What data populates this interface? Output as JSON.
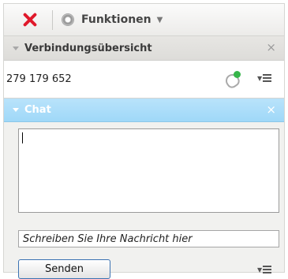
{
  "toolbar": {
    "close_icon": "red-x-icon",
    "functions_icon": "gear-icon",
    "functions_label": "Funktionen",
    "functions_arrow": "▼"
  },
  "connection_overview": {
    "title": "Verbindungsübersicht",
    "close_glyph": "×",
    "connection_id": "279 179 652",
    "remote_icon": "remote-control-icon",
    "menu_icon": "dropdown-menu-icon"
  },
  "chat": {
    "title": "Chat",
    "close_glyph": "×",
    "log_text": "",
    "input_placeholder": "Schreiben Sie Ihre Nachricht hier",
    "input_value": "",
    "send_label": "Senden",
    "menu_icon": "dropdown-menu-icon"
  },
  "colors": {
    "close_red": "#e0192b",
    "chat_header_blue": "#9fd8f8",
    "status_green": "#36b54a",
    "button_border_blue": "#3c73b3"
  }
}
